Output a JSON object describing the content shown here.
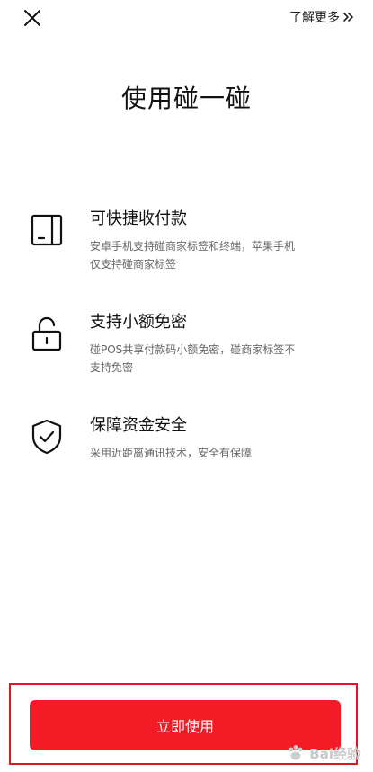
{
  "header": {
    "close_icon": "close-icon",
    "learn_more_label": "了解更多",
    "learn_more_icon": "double-chevron-right-icon"
  },
  "title": "使用碰一碰",
  "features": [
    {
      "icon": "phone-tablet-icon",
      "title": "可快捷收付款",
      "desc_line1": "安卓手机支持碰商家标签和终端，苹果手机",
      "desc_line2": "仅支持碰商家标签"
    },
    {
      "icon": "unlock-icon",
      "title": "支持小额免密",
      "desc_line1": "碰POS共享付款码小额免密，碰商家标签不",
      "desc_line2": "支持免密"
    },
    {
      "icon": "shield-check-icon",
      "title": "保障资金安全",
      "desc_line1": "采用近距离通讯技术，安全有保障"
    }
  ],
  "primary_button_label": "立即使用",
  "watermark": {
    "text": "Bai经验",
    "icon": "paw-icon"
  },
  "colors": {
    "accent": "#f31b26",
    "highlight_frame": "#e0171f",
    "text": "#111111",
    "muted_text": "#666666"
  }
}
